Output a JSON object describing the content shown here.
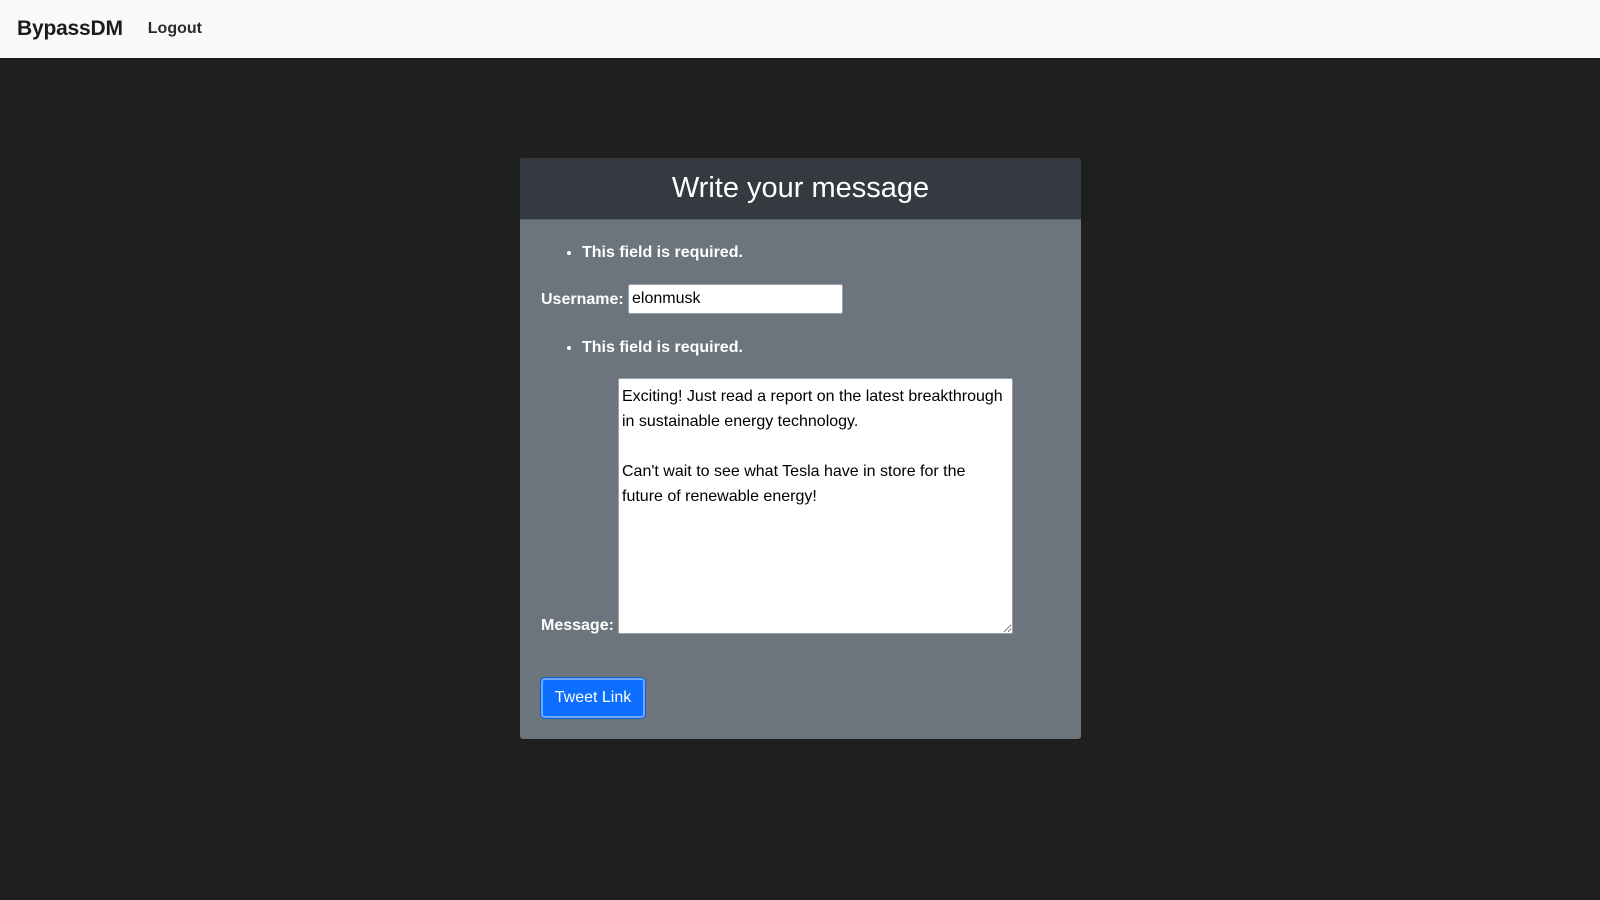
{
  "navbar": {
    "brand": "BypassDM",
    "logout_label": "Logout"
  },
  "form": {
    "title": "Write your message",
    "username_error": "This field is required.",
    "username_label": "Username:",
    "username_value": "elonmusk",
    "message_error": "This field is required.",
    "message_label": "Message:",
    "message_value": "Exciting! Just read a report on the latest breakthrough in sustainable energy technology.\n\nCan't wait to see what Tesla have in store for the future of renewable energy!",
    "submit_label": "Tweet Link"
  },
  "colors": {
    "page_background": "#1f1f1f",
    "navbar_background": "#f8f9fa",
    "card_header": "#343a40",
    "card_body": "#6c757d",
    "button_primary": "#0d6efd"
  }
}
